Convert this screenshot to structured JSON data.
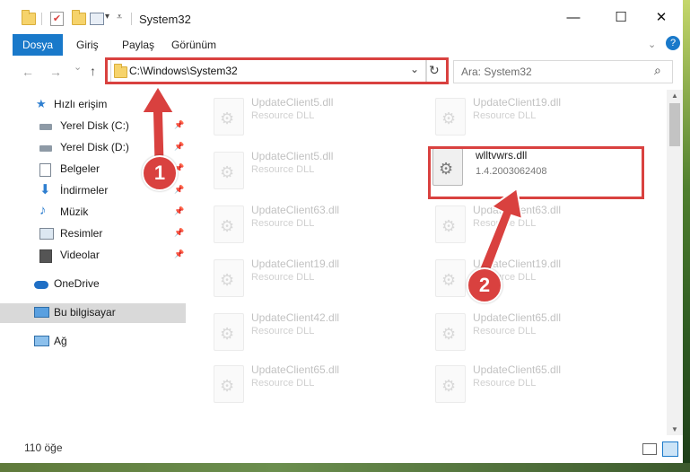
{
  "window": {
    "title": "System32",
    "minimize": "—",
    "maximize": "☐",
    "close": "✕"
  },
  "ribbon": {
    "tabs": [
      "Dosya",
      "Giriş",
      "Paylaş",
      "Görünüm"
    ],
    "help": "?"
  },
  "nav": {
    "back": "←",
    "forward": "→",
    "recent": "⌄",
    "up": "↑",
    "address": "C:\\Windows\\System32",
    "dropdown": "⌄",
    "refresh": "↻",
    "search_placeholder": "Ara: System32",
    "search_icon": "⌕"
  },
  "sidebar": {
    "items": [
      {
        "label": "Hızlı erişim",
        "icon": "star-icon",
        "pinned": false
      },
      {
        "label": "Yerel Disk (C:)",
        "icon": "drive-icon",
        "pinned": true
      },
      {
        "label": "Yerel Disk (D:)",
        "icon": "drive-icon",
        "pinned": true
      },
      {
        "label": "Belgeler",
        "icon": "documents-icon",
        "pinned": true
      },
      {
        "label": "İndirmeler",
        "icon": "download-icon",
        "pinned": true
      },
      {
        "label": "Müzik",
        "icon": "music-icon",
        "pinned": true
      },
      {
        "label": "Resimler",
        "icon": "pictures-icon",
        "pinned": true
      },
      {
        "label": "Videolar",
        "icon": "video-icon",
        "pinned": true
      },
      {
        "label": "OneDrive",
        "icon": "cloud-icon",
        "pinned": false
      },
      {
        "label": "Bu bilgisayar",
        "icon": "computer-icon",
        "pinned": false
      },
      {
        "label": "Ağ",
        "icon": "network-icon",
        "pinned": false
      }
    ]
  },
  "files": {
    "left": [
      {
        "name": "UpdateClient5.dll",
        "type": "Resource DLL"
      },
      {
        "name": "UpdateClient5.dll",
        "type": "Resource DLL"
      },
      {
        "name": "UpdateClient63.dll",
        "type": "Resource DLL"
      },
      {
        "name": "UpdateClient19.dll",
        "type": "Resource DLL"
      },
      {
        "name": "UpdateClient42.dll",
        "type": "Resource DLL"
      },
      {
        "name": "UpdateClient65.dll",
        "type": "Resource DLL"
      }
    ],
    "right": [
      {
        "name": "UpdateClient19.dll",
        "type": "Resource DLL"
      },
      {
        "name": "UpdateClient63.dll",
        "type": "Resource DLL"
      },
      {
        "name": "UpdateClient19.dll",
        "type": "Resource DLL"
      },
      {
        "name": "UpdateClient65.dll",
        "type": "Resource DLL"
      },
      {
        "name": "UpdateClient65.dll",
        "type": "Resource DLL"
      }
    ],
    "highlighted": {
      "name": "wlltvwrs.dll",
      "version": "1.4.2003062408"
    }
  },
  "status": {
    "count": "110 öğe"
  },
  "callouts": {
    "one": "1",
    "two": "2"
  },
  "colors": {
    "accent": "#1979ca",
    "annotation": "#d9413f"
  }
}
